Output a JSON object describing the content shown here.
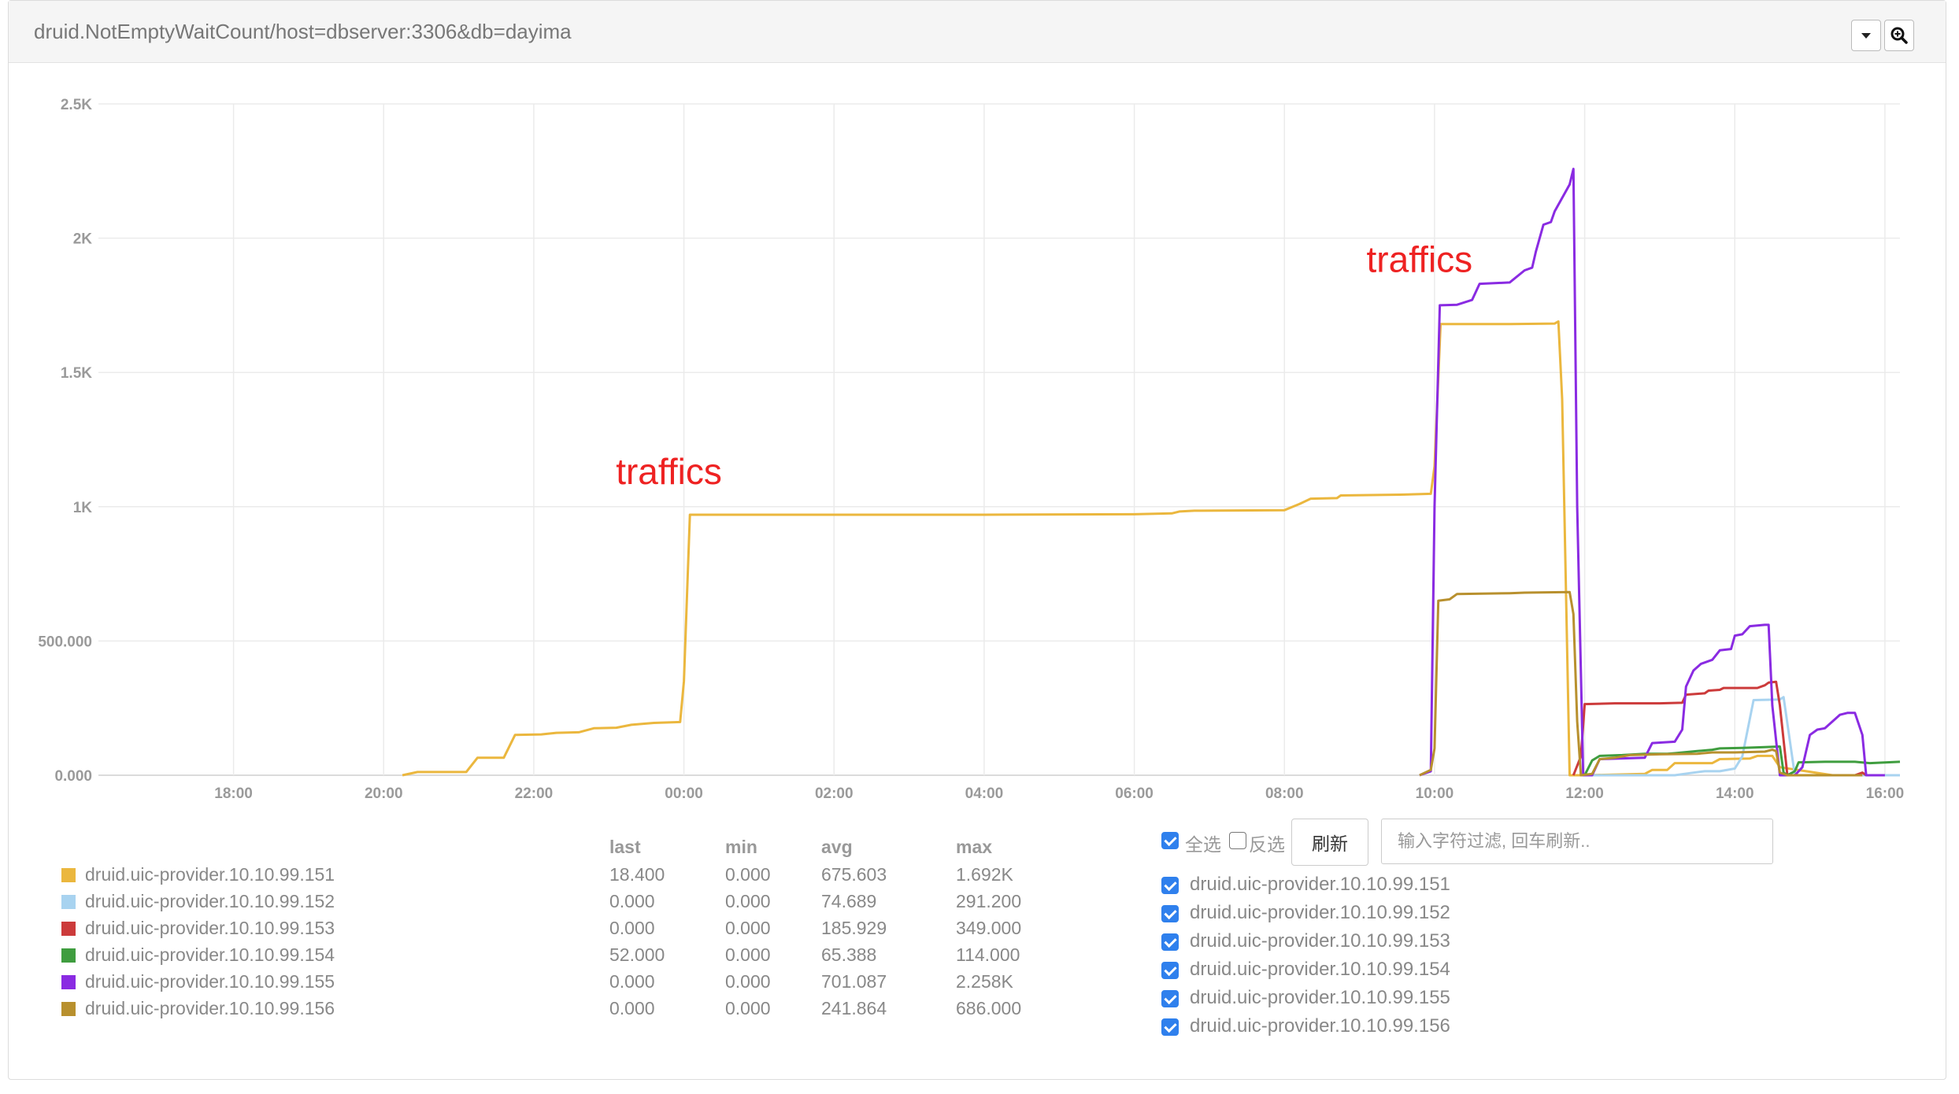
{
  "panel": {
    "title": "druid.NotEmptyWaitCount/host=dbserver:3306&db=dayima",
    "dropdown_icon": "caret-down-icon",
    "zoom_icon": "zoom-in-icon"
  },
  "chart_data": {
    "type": "line",
    "title": "",
    "xlabel": "",
    "ylabel": "",
    "ylim": [
      0,
      2500
    ],
    "y_ticks": [
      {
        "value": 0,
        "label": "0.000"
      },
      {
        "value": 500,
        "label": "500.000"
      },
      {
        "value": 1000,
        "label": "1K"
      },
      {
        "value": 1500,
        "label": "1.5K"
      },
      {
        "value": 2000,
        "label": "2K"
      },
      {
        "value": 2500,
        "label": "2.5K"
      }
    ],
    "x_ticks": [
      "18:00",
      "20:00",
      "22:00",
      "00:00",
      "02:00",
      "04:00",
      "06:00",
      "08:00",
      "10:00",
      "12:00",
      "14:00",
      "16:00"
    ],
    "x_tick_hours": [
      18,
      20,
      22,
      24,
      26,
      28,
      30,
      32,
      34,
      36,
      38,
      40
    ],
    "xlim_hours": [
      16.2,
      40.2
    ],
    "grid": true,
    "annotations": [
      {
        "text": "traffics",
        "x_hour": 23.8,
        "y": 1085,
        "color": "#ee2222"
      },
      {
        "text": "traffics",
        "x_hour": 33.8,
        "y": 1875,
        "color": "#ee2222"
      }
    ],
    "series": [
      {
        "name": "druid.uic-provider.10.10.99.151",
        "color": "#ebb73e",
        "points": [
          [
            20.25,
            0
          ],
          [
            20.45,
            12
          ],
          [
            21.1,
            12
          ],
          [
            21.25,
            65
          ],
          [
            21.6,
            65
          ],
          [
            21.75,
            150
          ],
          [
            22.1,
            152
          ],
          [
            22.3,
            158
          ],
          [
            22.6,
            160
          ],
          [
            22.8,
            175
          ],
          [
            23.1,
            177
          ],
          [
            23.3,
            188
          ],
          [
            23.6,
            195
          ],
          [
            23.95,
            198
          ],
          [
            24.0,
            350
          ],
          [
            24.08,
            970
          ],
          [
            26.0,
            970
          ],
          [
            28.0,
            970
          ],
          [
            30.0,
            972
          ],
          [
            30.5,
            975
          ],
          [
            30.6,
            982
          ],
          [
            30.8,
            985
          ],
          [
            32.0,
            987
          ],
          [
            32.2,
            1010
          ],
          [
            32.35,
            1030
          ],
          [
            32.7,
            1032
          ],
          [
            32.75,
            1042
          ],
          [
            33.6,
            1045
          ],
          [
            33.95,
            1048
          ],
          [
            34.0,
            1150
          ],
          [
            34.08,
            1680
          ],
          [
            35.0,
            1680
          ],
          [
            35.6,
            1682
          ],
          [
            35.65,
            1690
          ],
          [
            35.7,
            1400
          ],
          [
            35.8,
            0
          ],
          [
            36.0,
            0
          ],
          [
            36.8,
            5
          ],
          [
            36.9,
            20
          ],
          [
            37.1,
            20
          ],
          [
            37.2,
            45
          ],
          [
            37.7,
            45
          ],
          [
            37.8,
            60
          ],
          [
            38.2,
            62
          ],
          [
            38.3,
            72
          ],
          [
            38.5,
            72
          ],
          [
            38.6,
            30
          ],
          [
            39.3,
            0
          ],
          [
            39.8,
            0
          ]
        ]
      },
      {
        "name": "druid.uic-provider.10.10.99.152",
        "color": "#a8d3f0",
        "points": [
          [
            36.0,
            0
          ],
          [
            37.2,
            0
          ],
          [
            37.4,
            8
          ],
          [
            37.6,
            15
          ],
          [
            37.8,
            15
          ],
          [
            38.0,
            25
          ],
          [
            38.1,
            70
          ],
          [
            38.25,
            280
          ],
          [
            38.6,
            282
          ],
          [
            38.65,
            291
          ],
          [
            38.8,
            0
          ],
          [
            40.2,
            0
          ]
        ]
      },
      {
        "name": "druid.uic-provider.10.10.99.153",
        "color": "#cc3b3b",
        "points": [
          [
            35.85,
            0
          ],
          [
            35.95,
            70
          ],
          [
            36.0,
            265
          ],
          [
            36.4,
            268
          ],
          [
            37.0,
            268
          ],
          [
            37.3,
            270
          ],
          [
            37.35,
            300
          ],
          [
            37.6,
            305
          ],
          [
            37.65,
            315
          ],
          [
            37.8,
            318
          ],
          [
            37.85,
            325
          ],
          [
            38.3,
            325
          ],
          [
            38.4,
            335
          ],
          [
            38.45,
            345
          ],
          [
            38.55,
            348
          ],
          [
            38.6,
            260
          ],
          [
            38.7,
            0
          ],
          [
            39.6,
            0
          ],
          [
            39.7,
            10
          ],
          [
            39.75,
            0
          ]
        ]
      },
      {
        "name": "druid.uic-provider.10.10.99.154",
        "color": "#3f9d3f",
        "points": [
          [
            36.0,
            0
          ],
          [
            36.1,
            55
          ],
          [
            36.2,
            72
          ],
          [
            36.5,
            75
          ],
          [
            36.8,
            80
          ],
          [
            37.1,
            80
          ],
          [
            37.2,
            82
          ],
          [
            37.5,
            90
          ],
          [
            37.7,
            95
          ],
          [
            37.8,
            100
          ],
          [
            38.1,
            102
          ],
          [
            38.4,
            105
          ],
          [
            38.6,
            107
          ],
          [
            38.65,
            10
          ],
          [
            38.7,
            0
          ],
          [
            38.8,
            15
          ],
          [
            38.85,
            48
          ],
          [
            39.2,
            50
          ],
          [
            39.6,
            50
          ],
          [
            39.8,
            45
          ],
          [
            40.2,
            50
          ]
        ]
      },
      {
        "name": "druid.uic-provider.10.10.99.155",
        "color": "#8a2be2",
        "points": [
          [
            33.8,
            0
          ],
          [
            33.95,
            15
          ],
          [
            34.0,
            1000
          ],
          [
            34.07,
            1750
          ],
          [
            34.3,
            1752
          ],
          [
            34.5,
            1770
          ],
          [
            34.6,
            1830
          ],
          [
            35.0,
            1835
          ],
          [
            35.2,
            1880
          ],
          [
            35.3,
            1890
          ],
          [
            35.35,
            1950
          ],
          [
            35.45,
            2050
          ],
          [
            35.55,
            2060
          ],
          [
            35.6,
            2100
          ],
          [
            35.8,
            2200
          ],
          [
            35.85,
            2258
          ],
          [
            35.9,
            1000
          ],
          [
            35.98,
            0
          ],
          [
            36.1,
            0
          ],
          [
            36.2,
            60
          ],
          [
            36.8,
            65
          ],
          [
            36.9,
            120
          ],
          [
            37.2,
            125
          ],
          [
            37.3,
            170
          ],
          [
            37.35,
            330
          ],
          [
            37.45,
            390
          ],
          [
            37.55,
            415
          ],
          [
            37.7,
            430
          ],
          [
            37.8,
            465
          ],
          [
            37.95,
            470
          ],
          [
            38.0,
            520
          ],
          [
            38.1,
            525
          ],
          [
            38.2,
            555
          ],
          [
            38.4,
            560
          ],
          [
            38.45,
            560
          ],
          [
            38.5,
            260
          ],
          [
            38.6,
            0
          ],
          [
            38.8,
            0
          ],
          [
            38.9,
            30
          ],
          [
            39.0,
            150
          ],
          [
            39.1,
            170
          ],
          [
            39.2,
            175
          ],
          [
            39.4,
            225
          ],
          [
            39.5,
            232
          ],
          [
            39.6,
            232
          ],
          [
            39.7,
            150
          ],
          [
            39.75,
            0
          ],
          [
            40.0,
            0
          ]
        ]
      },
      {
        "name": "druid.uic-provider.10.10.99.156",
        "color": "#b8902e",
        "points": [
          [
            33.8,
            0
          ],
          [
            33.95,
            20
          ],
          [
            34.0,
            100
          ],
          [
            34.05,
            650
          ],
          [
            34.2,
            655
          ],
          [
            34.3,
            675
          ],
          [
            35.0,
            678
          ],
          [
            35.2,
            680
          ],
          [
            35.8,
            682
          ],
          [
            35.85,
            600
          ],
          [
            35.9,
            200
          ],
          [
            35.95,
            0
          ],
          [
            36.1,
            5
          ],
          [
            36.2,
            60
          ],
          [
            36.4,
            65
          ],
          [
            36.6,
            75
          ],
          [
            37.0,
            78
          ],
          [
            37.5,
            80
          ],
          [
            37.7,
            85
          ],
          [
            38.0,
            85
          ],
          [
            38.4,
            88
          ],
          [
            38.5,
            95
          ],
          [
            38.55,
            90
          ],
          [
            38.6,
            10
          ],
          [
            38.7,
            0
          ],
          [
            39.7,
            0
          ]
        ]
      }
    ]
  },
  "legend": {
    "columns": [
      "last",
      "min",
      "avg",
      "max"
    ],
    "rows": [
      {
        "name": "druid.uic-provider.10.10.99.151",
        "color": "#ebb73e",
        "last": "18.400",
        "min": "0.000",
        "avg": "675.603",
        "max": "1.692K"
      },
      {
        "name": "druid.uic-provider.10.10.99.152",
        "color": "#a8d3f0",
        "last": "0.000",
        "min": "0.000",
        "avg": "74.689",
        "max": "291.200"
      },
      {
        "name": "druid.uic-provider.10.10.99.153",
        "color": "#cc3b3b",
        "last": "0.000",
        "min": "0.000",
        "avg": "185.929",
        "max": "349.000"
      },
      {
        "name": "druid.uic-provider.10.10.99.154",
        "color": "#3f9d3f",
        "last": "52.000",
        "min": "0.000",
        "avg": "65.388",
        "max": "114.000"
      },
      {
        "name": "druid.uic-provider.10.10.99.155",
        "color": "#8a2be2",
        "last": "0.000",
        "min": "0.000",
        "avg": "701.087",
        "max": "2.258K"
      },
      {
        "name": "druid.uic-provider.10.10.99.156",
        "color": "#b8902e",
        "last": "0.000",
        "min": "0.000",
        "avg": "241.864",
        "max": "686.000"
      }
    ]
  },
  "controls": {
    "select_all_label": "全选",
    "select_all_checked": true,
    "invert_label": "反选",
    "invert_checked": false,
    "refresh_label": "刷新",
    "filter_placeholder": "输入字符过滤, 回车刷新..",
    "filter_value": ""
  },
  "selection": [
    {
      "label": "druid.uic-provider.10.10.99.151",
      "checked": true
    },
    {
      "label": "druid.uic-provider.10.10.99.152",
      "checked": true
    },
    {
      "label": "druid.uic-provider.10.10.99.153",
      "checked": true
    },
    {
      "label": "druid.uic-provider.10.10.99.154",
      "checked": true
    },
    {
      "label": "druid.uic-provider.10.10.99.155",
      "checked": true
    },
    {
      "label": "druid.uic-provider.10.10.99.156",
      "checked": true
    }
  ]
}
